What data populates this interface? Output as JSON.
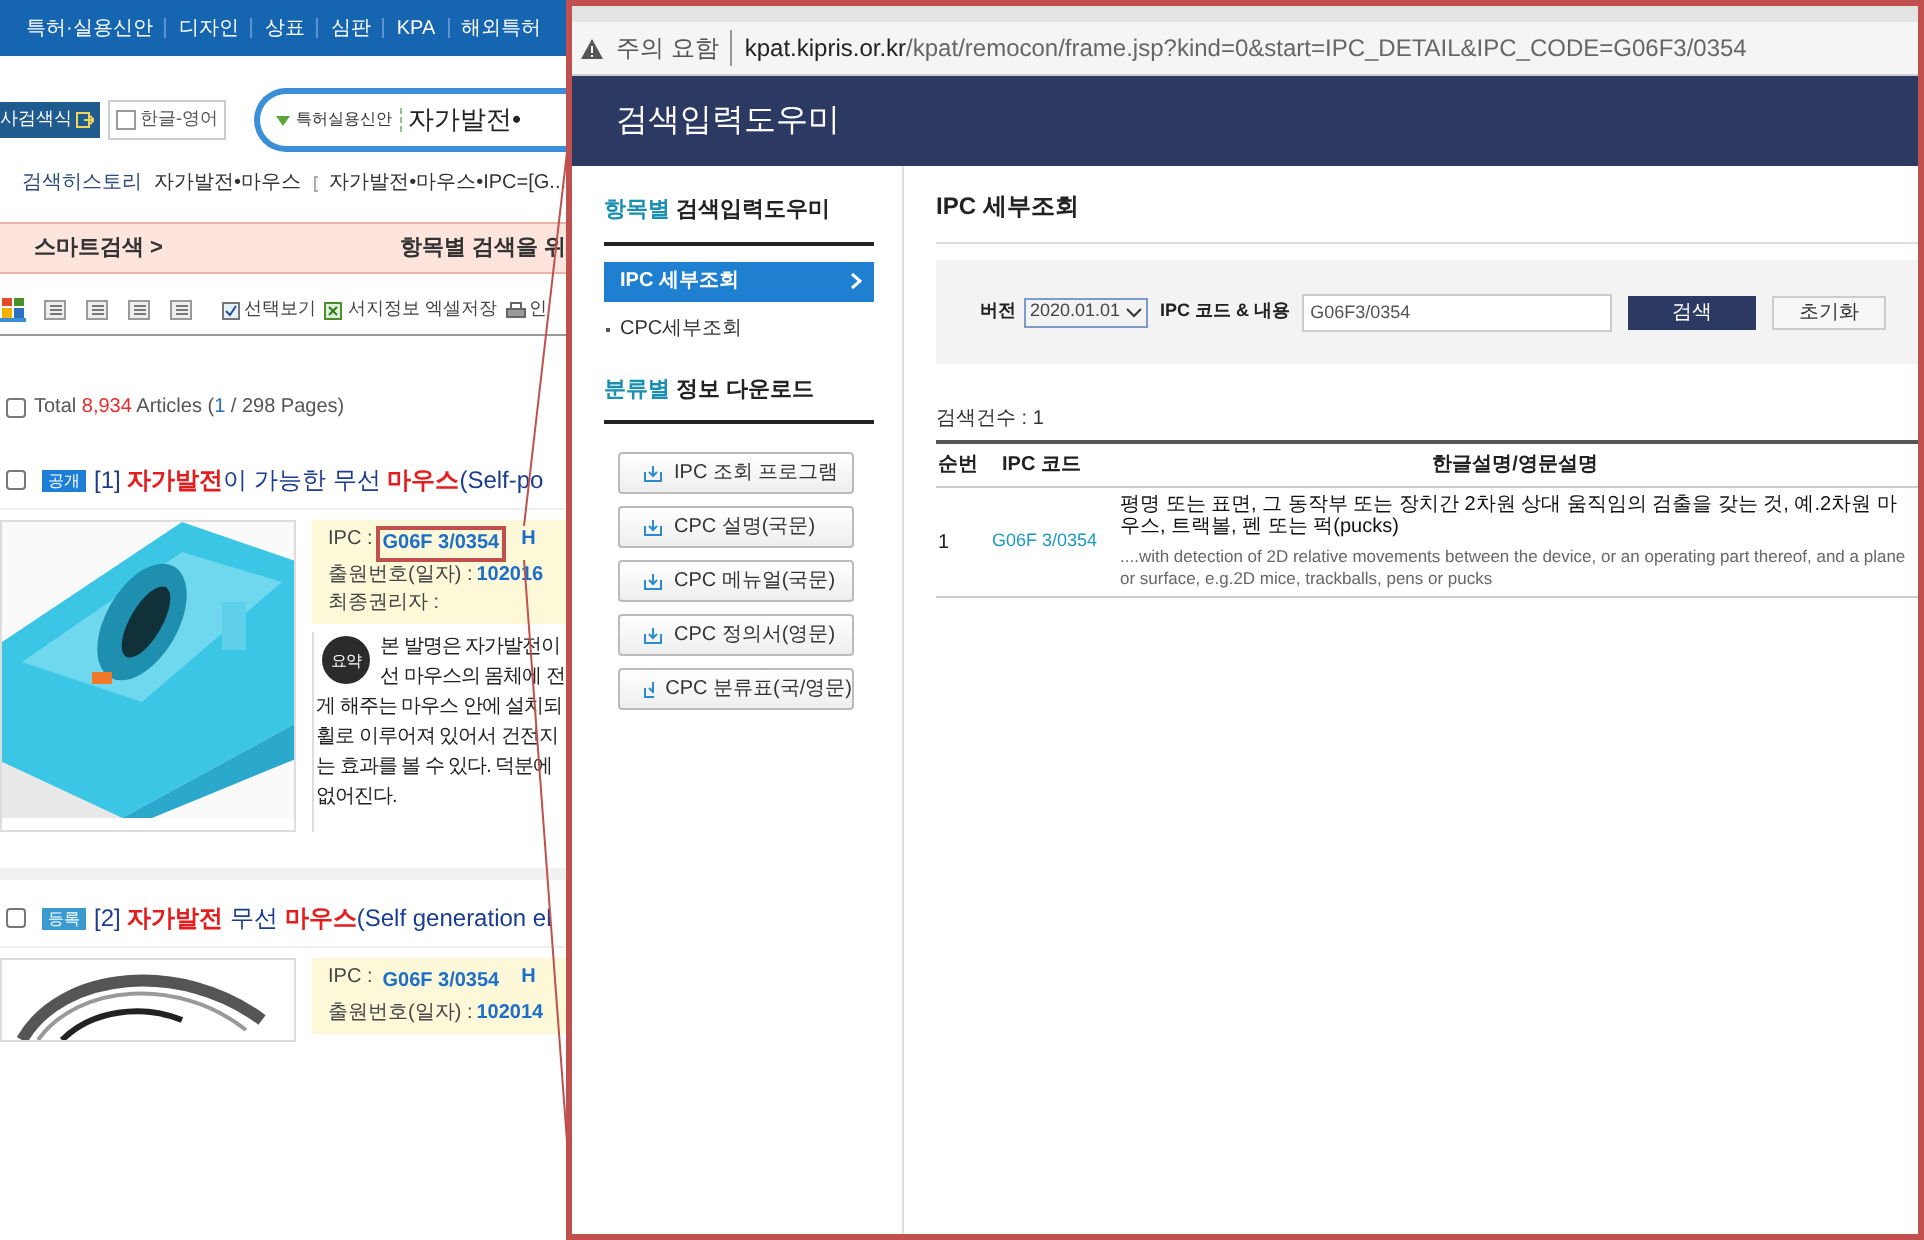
{
  "top_nav": [
    "특허·실용신안",
    "디자인",
    "상표",
    "심판",
    "KPA",
    "해외특허"
  ],
  "search_bar": {
    "formula_button": "사검색식",
    "language_checkbox": {
      "label": "한글-영어",
      "checked": false
    },
    "category": "특허실용신안",
    "query": "자가발전•"
  },
  "history": {
    "label": "검색히스토리",
    "items": [
      "자가발전•마우스",
      "자가발전•마우스•IPC=[G..."
    ]
  },
  "smart_search": {
    "label": "스마트검색 >",
    "notice": "항목별 검색을 위"
  },
  "toolbar": {
    "view_modes": [
      {
        "selected": true
      },
      {
        "selected": false
      },
      {
        "selected": false
      },
      {
        "selected": false
      },
      {
        "selected": false
      }
    ],
    "select_view": {
      "label": "선택보기",
      "checked": true
    },
    "excel_label": "서지정보 엑셀저장",
    "print_label": "인"
  },
  "total": {
    "checked": false,
    "label": "Total",
    "count": "8,934",
    "articles": "Articles (",
    "page": "1",
    "pages": "/ 298 Pages)"
  },
  "results": [
    {
      "checked": false,
      "status": "공개",
      "number": "[1]",
      "title_parts": [
        {
          "text": "자가발전",
          "highlight": true
        },
        {
          "text": "이 가능한 무선 ",
          "highlight": false
        },
        {
          "text": "마우스",
          "highlight": true
        },
        {
          "text": "(Self-po",
          "highlight": false
        }
      ],
      "kind": "picture",
      "ipc_label": "IPC :",
      "ipc": "G06F 3/0354",
      "ipc_marked": true,
      "ipc_extra": "H",
      "application_label": "출원번호(일자) :",
      "application": "102016",
      "owner_label": "최종권리자 :",
      "summary_badge": "요약",
      "summary": [
        "본 발명은 자가발전이",
        "선 마우스의 몸체에 전",
        "게 해주는 마우스 안에 설치되",
        "휠로 이루어져 있어서 건전지",
        "는 효과를 볼 수 있다. 덕분에",
        "없어진다."
      ]
    },
    {
      "checked": false,
      "status": "등록",
      "number": "[2]",
      "title_parts": [
        {
          "text": "자가발전",
          "highlight": true
        },
        {
          "text": " 무선 ",
          "highlight": false
        },
        {
          "text": "마우스",
          "highlight": true
        },
        {
          "text": "(Self generation el",
          "highlight": false
        }
      ],
      "kind": "picture",
      "ipc_label": "IPC :",
      "ipc": "G06F 3/0354",
      "ipc_marked": false,
      "ipc_extra": "H",
      "application_label": "출원번호(일자) :",
      "application": "102014"
    }
  ],
  "popup": {
    "warning": "주의 요함",
    "url_host": "kpat.kipris.or.kr",
    "url_path": "/kpat/remocon/frame.jsp?kind=0&start=IPC_DETAIL&IPC_CODE=G06F3/0354",
    "header": "검색입력도우미",
    "sidebar": {
      "section_1": {
        "highlight": "항목별",
        "title": " 검색입력도우미"
      },
      "items": [
        {
          "label": "IPC 세부조회",
          "selected": true
        },
        {
          "label": "CPC세부조회",
          "selected": false
        }
      ],
      "section_2": {
        "highlight": "분류별",
        "title": " 정보 다운로드"
      },
      "downloads": [
        "IPC 조회 프로그램",
        "CPC 설명(국문)",
        "CPC 메뉴얼(국문)",
        "CPC 정의서(영문)",
        "CPC 분류표(국/영문)"
      ]
    },
    "title": "IPC 세부조회",
    "version_label": "버전",
    "version": "2020.01.01",
    "code_label": "IPC 코드 & 내용",
    "code_value": "G06F3/0354",
    "search_button": "검색",
    "reset_button": "초기화",
    "count": "검색건수 : 1",
    "table": {
      "columns": [
        "순번",
        "IPC 코드",
        "한글설명/영문설명"
      ],
      "rows": [
        {
          "index": "1",
          "code": "G06F 3/0354",
          "korean": "평명 또는 표면, 그 동작부 또는 장치간 2차원 상대 움직임의 검출을 갖는 것, 예.2차원 마우스, 트랙볼, 펜 또는 퍽(pucks)",
          "english": "....with detection of 2D relative movements between the device, or an operating part thereof, and a plane or surface, e.g.2D mice, trackballs, pens or pucks"
        }
      ]
    }
  }
}
